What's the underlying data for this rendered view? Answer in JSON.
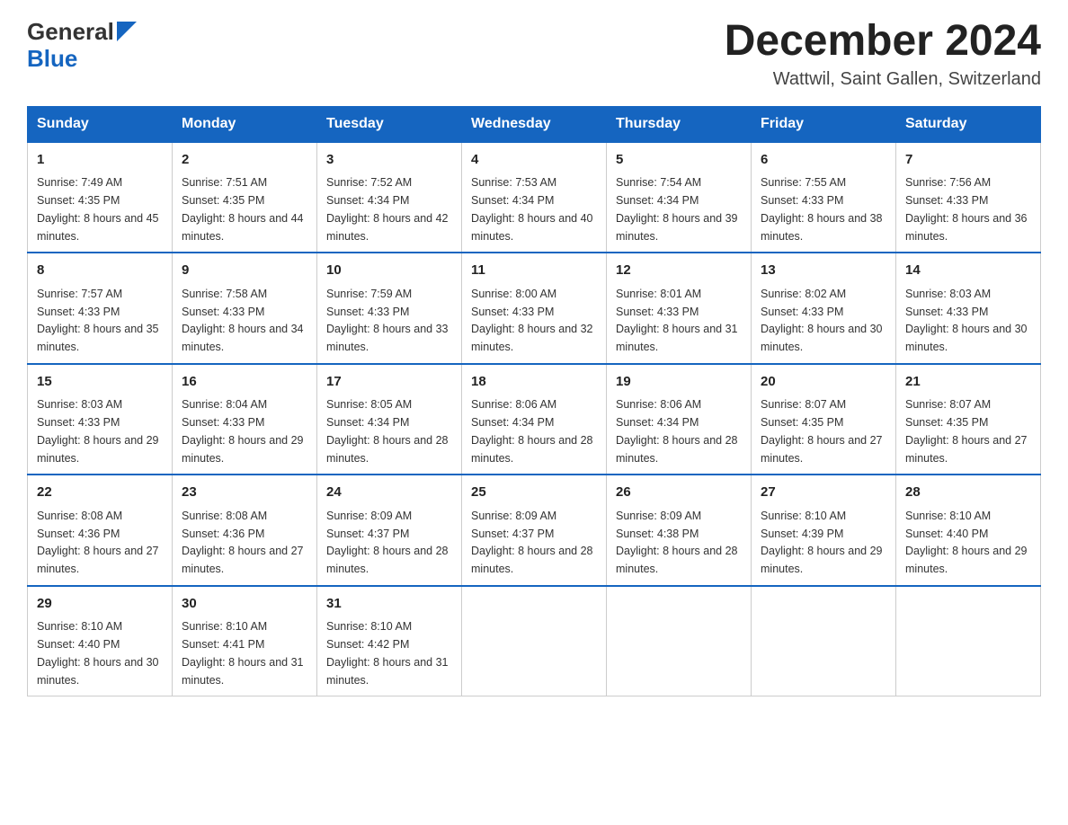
{
  "header": {
    "logo_general": "General",
    "logo_blue": "Blue",
    "title": "December 2024",
    "location": "Wattwil, Saint Gallen, Switzerland"
  },
  "weekdays": [
    "Sunday",
    "Monday",
    "Tuesday",
    "Wednesday",
    "Thursday",
    "Friday",
    "Saturday"
  ],
  "weeks": [
    [
      {
        "day": "1",
        "sunrise": "7:49 AM",
        "sunset": "4:35 PM",
        "daylight": "8 hours and 45 minutes."
      },
      {
        "day": "2",
        "sunrise": "7:51 AM",
        "sunset": "4:35 PM",
        "daylight": "8 hours and 44 minutes."
      },
      {
        "day": "3",
        "sunrise": "7:52 AM",
        "sunset": "4:34 PM",
        "daylight": "8 hours and 42 minutes."
      },
      {
        "day": "4",
        "sunrise": "7:53 AM",
        "sunset": "4:34 PM",
        "daylight": "8 hours and 40 minutes."
      },
      {
        "day": "5",
        "sunrise": "7:54 AM",
        "sunset": "4:34 PM",
        "daylight": "8 hours and 39 minutes."
      },
      {
        "day": "6",
        "sunrise": "7:55 AM",
        "sunset": "4:33 PM",
        "daylight": "8 hours and 38 minutes."
      },
      {
        "day": "7",
        "sunrise": "7:56 AM",
        "sunset": "4:33 PM",
        "daylight": "8 hours and 36 minutes."
      }
    ],
    [
      {
        "day": "8",
        "sunrise": "7:57 AM",
        "sunset": "4:33 PM",
        "daylight": "8 hours and 35 minutes."
      },
      {
        "day": "9",
        "sunrise": "7:58 AM",
        "sunset": "4:33 PM",
        "daylight": "8 hours and 34 minutes."
      },
      {
        "day": "10",
        "sunrise": "7:59 AM",
        "sunset": "4:33 PM",
        "daylight": "8 hours and 33 minutes."
      },
      {
        "day": "11",
        "sunrise": "8:00 AM",
        "sunset": "4:33 PM",
        "daylight": "8 hours and 32 minutes."
      },
      {
        "day": "12",
        "sunrise": "8:01 AM",
        "sunset": "4:33 PM",
        "daylight": "8 hours and 31 minutes."
      },
      {
        "day": "13",
        "sunrise": "8:02 AM",
        "sunset": "4:33 PM",
        "daylight": "8 hours and 30 minutes."
      },
      {
        "day": "14",
        "sunrise": "8:03 AM",
        "sunset": "4:33 PM",
        "daylight": "8 hours and 30 minutes."
      }
    ],
    [
      {
        "day": "15",
        "sunrise": "8:03 AM",
        "sunset": "4:33 PM",
        "daylight": "8 hours and 29 minutes."
      },
      {
        "day": "16",
        "sunrise": "8:04 AM",
        "sunset": "4:33 PM",
        "daylight": "8 hours and 29 minutes."
      },
      {
        "day": "17",
        "sunrise": "8:05 AM",
        "sunset": "4:34 PM",
        "daylight": "8 hours and 28 minutes."
      },
      {
        "day": "18",
        "sunrise": "8:06 AM",
        "sunset": "4:34 PM",
        "daylight": "8 hours and 28 minutes."
      },
      {
        "day": "19",
        "sunrise": "8:06 AM",
        "sunset": "4:34 PM",
        "daylight": "8 hours and 28 minutes."
      },
      {
        "day": "20",
        "sunrise": "8:07 AM",
        "sunset": "4:35 PM",
        "daylight": "8 hours and 27 minutes."
      },
      {
        "day": "21",
        "sunrise": "8:07 AM",
        "sunset": "4:35 PM",
        "daylight": "8 hours and 27 minutes."
      }
    ],
    [
      {
        "day": "22",
        "sunrise": "8:08 AM",
        "sunset": "4:36 PM",
        "daylight": "8 hours and 27 minutes."
      },
      {
        "day": "23",
        "sunrise": "8:08 AM",
        "sunset": "4:36 PM",
        "daylight": "8 hours and 27 minutes."
      },
      {
        "day": "24",
        "sunrise": "8:09 AM",
        "sunset": "4:37 PM",
        "daylight": "8 hours and 28 minutes."
      },
      {
        "day": "25",
        "sunrise": "8:09 AM",
        "sunset": "4:37 PM",
        "daylight": "8 hours and 28 minutes."
      },
      {
        "day": "26",
        "sunrise": "8:09 AM",
        "sunset": "4:38 PM",
        "daylight": "8 hours and 28 minutes."
      },
      {
        "day": "27",
        "sunrise": "8:10 AM",
        "sunset": "4:39 PM",
        "daylight": "8 hours and 29 minutes."
      },
      {
        "day": "28",
        "sunrise": "8:10 AM",
        "sunset": "4:40 PM",
        "daylight": "8 hours and 29 minutes."
      }
    ],
    [
      {
        "day": "29",
        "sunrise": "8:10 AM",
        "sunset": "4:40 PM",
        "daylight": "8 hours and 30 minutes."
      },
      {
        "day": "30",
        "sunrise": "8:10 AM",
        "sunset": "4:41 PM",
        "daylight": "8 hours and 31 minutes."
      },
      {
        "day": "31",
        "sunrise": "8:10 AM",
        "sunset": "4:42 PM",
        "daylight": "8 hours and 31 minutes."
      },
      null,
      null,
      null,
      null
    ]
  ]
}
